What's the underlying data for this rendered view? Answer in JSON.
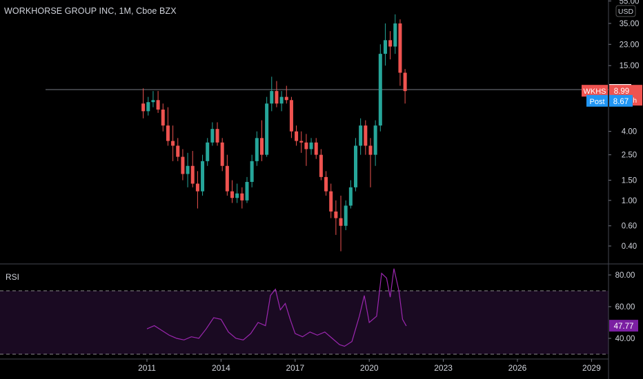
{
  "header": {
    "title": "WORKHORSE GROUP INC, 1M, Cboe BZX",
    "currency": "USD"
  },
  "rsi_panel": {
    "label": "RSI"
  },
  "badges": {
    "symbol": "WKHS",
    "last_price": "8.99",
    "countdown": "8d 23h",
    "hline_price": "9.26",
    "post_label": "Post",
    "post_price": "8.67",
    "rsi_value": "47.77"
  },
  "colors": {
    "background": "#000000",
    "up": "#26a69a",
    "down": "#ef5350",
    "rsi_line": "#9c27b0",
    "rsi_band": "#1a0a22",
    "post_badge": "#2196f3",
    "rsi_badge": "#7b1fa2",
    "text": "#d1d4dc"
  },
  "chart_data": [
    {
      "type": "candlestick",
      "title": "WORKHORSE GROUP INC, 1M, Cboe BZX",
      "y_scale": "log",
      "y_ticks": [
        "0.40",
        "0.60",
        "1.00",
        "1.50",
        "2.50",
        "4.00",
        "9.26",
        "15.00",
        "23.00",
        "35.00",
        "55.00"
      ],
      "x_ticks": [
        "2011",
        "2014",
        "2017",
        "2020",
        "2023",
        "2026",
        "2029"
      ],
      "horizontal_line": 9.26,
      "last_price": 8.99,
      "post_price": 8.67,
      "series": [
        {
          "values": [
            [
              2010.85,
              7.0,
              9.5,
              5.2,
              6.0
            ],
            [
              2011.05,
              6.0,
              8.0,
              5.5,
              7.2
            ],
            [
              2011.25,
              7.2,
              9.0,
              6.5,
              7.5
            ],
            [
              2011.45,
              7.5,
              9.0,
              5.8,
              6.2
            ],
            [
              2011.65,
              6.2,
              7.0,
              4.0,
              4.5
            ],
            [
              2011.85,
              4.5,
              6.5,
              3.0,
              3.3
            ],
            [
              2012.05,
              3.3,
              4.5,
              2.2,
              3.0
            ],
            [
              2012.25,
              3.0,
              3.5,
              2.2,
              2.4
            ],
            [
              2012.45,
              2.4,
              2.8,
              1.5,
              1.7
            ],
            [
              2012.65,
              1.7,
              2.6,
              1.3,
              2.0
            ],
            [
              2012.85,
              2.0,
              2.7,
              1.3,
              1.4
            ],
            [
              2013.05,
              1.4,
              1.8,
              0.85,
              1.2
            ],
            [
              2013.25,
              1.2,
              2.5,
              1.1,
              2.2
            ],
            [
              2013.45,
              2.2,
              3.5,
              2.0,
              3.2
            ],
            [
              2013.65,
              3.2,
              4.8,
              3.0,
              4.2
            ],
            [
              2013.85,
              4.2,
              4.8,
              3.0,
              3.2
            ],
            [
              2014.05,
              3.2,
              3.5,
              1.8,
              2.0
            ],
            [
              2014.25,
              2.0,
              2.5,
              1.1,
              1.2
            ],
            [
              2014.45,
              1.2,
              1.5,
              0.95,
              1.05
            ],
            [
              2014.65,
              1.05,
              1.4,
              0.95,
              1.15
            ],
            [
              2014.85,
              1.15,
              1.3,
              0.85,
              1.0
            ],
            [
              2015.05,
              1.0,
              1.6,
              0.95,
              1.45
            ],
            [
              2015.25,
              1.45,
              2.5,
              1.3,
              2.2
            ],
            [
              2015.45,
              2.2,
              4.0,
              2.0,
              3.5
            ],
            [
              2015.65,
              3.5,
              5.0,
              2.2,
              2.5
            ],
            [
              2015.85,
              2.5,
              8.0,
              2.4,
              7.0
            ],
            [
              2016.05,
              7.0,
              12.0,
              6.0,
              9.0
            ],
            [
              2016.25,
              9.0,
              11.0,
              6.5,
              7.0
            ],
            [
              2016.45,
              7.0,
              9.0,
              6.0,
              8.0
            ],
            [
              2016.65,
              8.0,
              10.0,
              7.0,
              7.5
            ],
            [
              2016.85,
              7.5,
              8.0,
              3.5,
              4.0
            ],
            [
              2017.05,
              4.0,
              4.5,
              3.0,
              3.3
            ],
            [
              2017.25,
              3.3,
              4.0,
              2.6,
              3.2
            ],
            [
              2017.45,
              3.2,
              3.8,
              2.0,
              2.8
            ],
            [
              2017.65,
              2.8,
              3.5,
              2.5,
              3.2
            ],
            [
              2017.85,
              3.2,
              3.5,
              2.3,
              2.5
            ],
            [
              2018.05,
              2.5,
              2.8,
              1.5,
              1.6
            ],
            [
              2018.25,
              1.6,
              1.8,
              1.1,
              1.2
            ],
            [
              2018.45,
              1.2,
              1.4,
              0.7,
              0.8
            ],
            [
              2018.65,
              0.8,
              1.0,
              0.5,
              0.7
            ],
            [
              2018.85,
              0.7,
              1.1,
              0.36,
              0.6
            ],
            [
              2019.05,
              0.6,
              1.0,
              0.55,
              0.9
            ],
            [
              2019.25,
              0.9,
              1.5,
              0.85,
              1.3
            ],
            [
              2019.45,
              1.3,
              3.5,
              1.2,
              3.0
            ],
            [
              2019.65,
              3.0,
              5.2,
              2.5,
              4.5
            ],
            [
              2019.85,
              4.5,
              5.0,
              2.5,
              3.0
            ],
            [
              2020.05,
              3.0,
              3.5,
              1.3,
              2.5
            ],
            [
              2020.25,
              2.5,
              5.0,
              2.0,
              4.5
            ],
            [
              2020.45,
              4.5,
              23.0,
              4.0,
              19.0
            ],
            [
              2020.65,
              19.0,
              35.0,
              15.0,
              25.0
            ],
            [
              2020.85,
              25.0,
              30.0,
              17.0,
              22.0
            ],
            [
              2021.05,
              22.0,
              42.0,
              19.0,
              35.0
            ],
            [
              2021.25,
              35.0,
              38.0,
              10.0,
              13.0
            ],
            [
              2021.45,
              13.0,
              14.0,
              7.0,
              8.99
            ]
          ]
        }
      ]
    },
    {
      "type": "line",
      "title": "RSI",
      "y_ticks": [
        "40.00",
        "60.00",
        "80.00"
      ],
      "band": [
        30,
        70
      ],
      "last_value": 47.77,
      "series": [
        {
          "values": [
            [
              2011.0,
              46
            ],
            [
              2011.3,
              48
            ],
            [
              2011.6,
              45
            ],
            [
              2011.9,
              42
            ],
            [
              2012.2,
              40
            ],
            [
              2012.5,
              39
            ],
            [
              2012.8,
              41
            ],
            [
              2013.1,
              40
            ],
            [
              2013.4,
              46
            ],
            [
              2013.7,
              53
            ],
            [
              2014.0,
              52
            ],
            [
              2014.3,
              44
            ],
            [
              2014.6,
              40
            ],
            [
              2014.9,
              39
            ],
            [
              2015.2,
              43
            ],
            [
              2015.5,
              50
            ],
            [
              2015.8,
              48
            ],
            [
              2016.0,
              67
            ],
            [
              2016.2,
              71
            ],
            [
              2016.4,
              58
            ],
            [
              2016.6,
              62
            ],
            [
              2016.8,
              52
            ],
            [
              2017.0,
              43
            ],
            [
              2017.3,
              41
            ],
            [
              2017.6,
              44
            ],
            [
              2017.9,
              42
            ],
            [
              2018.2,
              44
            ],
            [
              2018.5,
              40
            ],
            [
              2018.8,
              36
            ],
            [
              2019.0,
              35
            ],
            [
              2019.3,
              38
            ],
            [
              2019.6,
              54
            ],
            [
              2019.8,
              67
            ],
            [
              2020.0,
              50
            ],
            [
              2020.3,
              54
            ],
            [
              2020.5,
              81
            ],
            [
              2020.7,
              78
            ],
            [
              2020.85,
              66
            ],
            [
              2021.0,
              84
            ],
            [
              2021.2,
              70
            ],
            [
              2021.35,
              52
            ],
            [
              2021.5,
              47.77
            ]
          ]
        }
      ]
    }
  ]
}
